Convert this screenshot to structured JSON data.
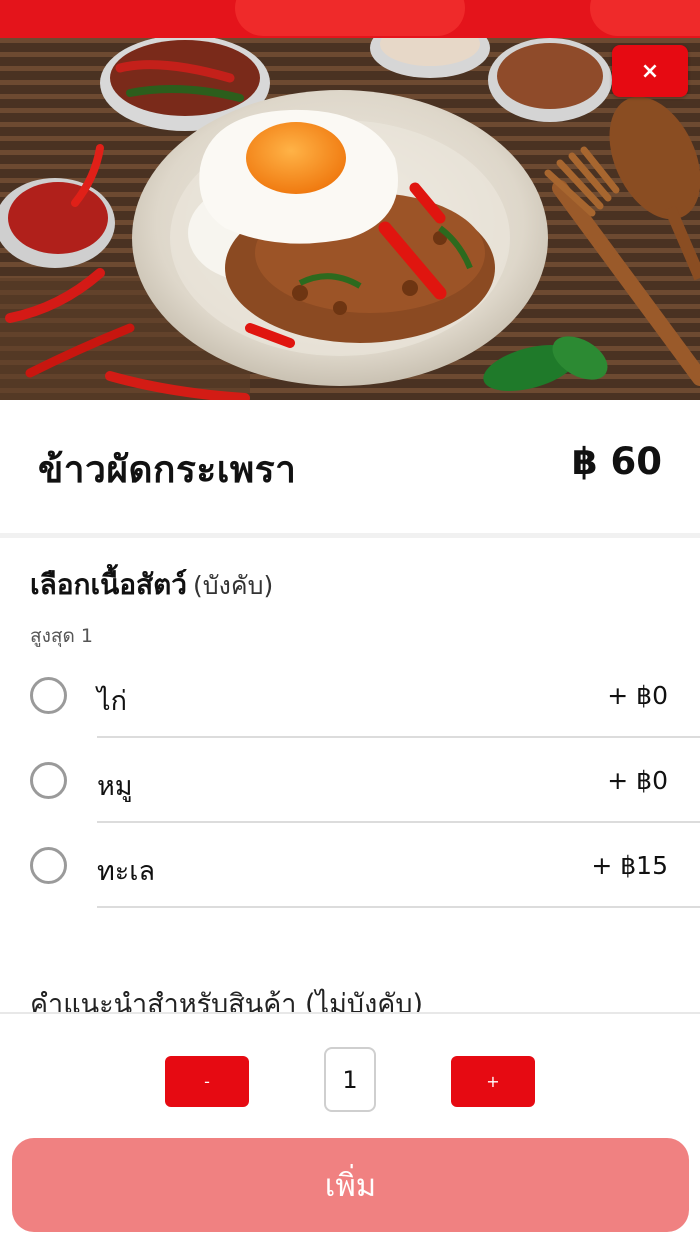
{
  "product": {
    "name": "ข้าวผัดกระเพรา",
    "price": "฿ 60",
    "image_alt": "ข้าวผัดกระเพรา"
  },
  "close_button": {
    "icon": "close-icon",
    "symbol": "×"
  },
  "option_group": {
    "title": "เลือกเนื้อสัตว์",
    "required_label": "(บังคับ)",
    "max_label": "สูงสุด 1",
    "options": [
      {
        "label": "ไก่",
        "price": "+ ฿0"
      },
      {
        "label": "หมู",
        "price": "+ ฿0"
      },
      {
        "label": "ทะเล",
        "price": "+ ฿15"
      }
    ]
  },
  "note": {
    "heading": "คำแนะนำสำหรับสินค้า (ไม่บังคับ)"
  },
  "quantity": {
    "minus_label": "-",
    "value": "1",
    "plus_label": "+"
  },
  "add_button": {
    "label": "เพิ่ม"
  },
  "colors": {
    "brand_red": "#e60a12",
    "add_button_disabled": "#f08181",
    "divider": "#dcdcdc"
  }
}
